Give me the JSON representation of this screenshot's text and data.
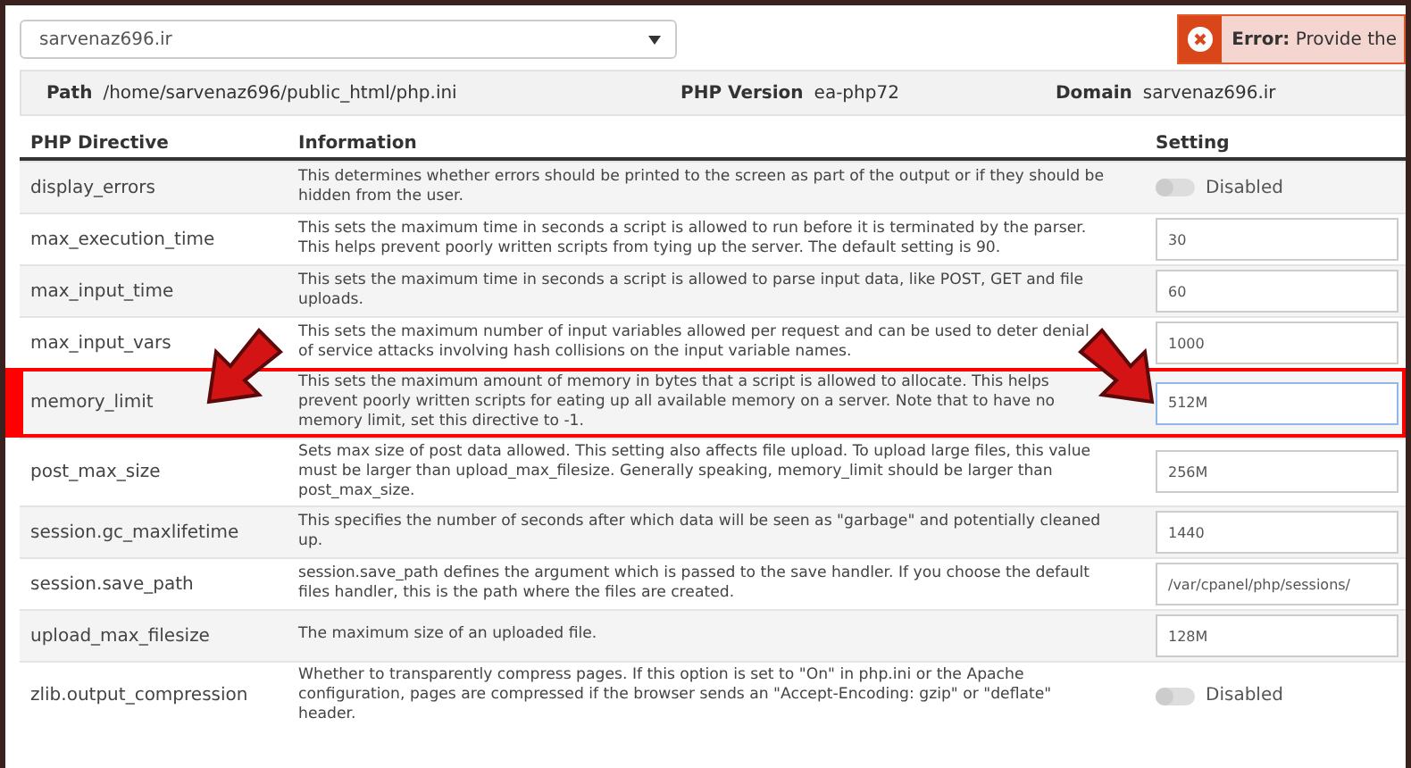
{
  "site_select": {
    "value": "sarvenaz696.ir"
  },
  "error": {
    "message": "**Error:** Provide the"
  },
  "info_bar": [
    {
      "label": "Path",
      "value": "/home/sarvenaz696/public_html/php.ini"
    },
    {
      "label": "PHP Version",
      "value": "ea-php72"
    },
    {
      "label": "Domain",
      "value": "sarvenaz696.ir"
    }
  ],
  "table": {
    "columns": [
      "PHP Directive",
      "Information",
      "Setting"
    ],
    "rows": [
      {
        "directive": "display_errors",
        "info": "This determines whether errors should be printed to the screen as part of the output or if they should be hidden from the user.",
        "kind": "toggle",
        "on": false,
        "value": "Disabled",
        "highlighted": false
      },
      {
        "directive": "max_execution_time",
        "info": "This sets the maximum time in seconds a script is allowed to run before it is terminated by the parser. This helps prevent poorly written scripts from tying up the server. The default setting is 90.",
        "kind": "text",
        "value": "30",
        "highlighted": false
      },
      {
        "directive": "max_input_time",
        "info": "This sets the maximum time in seconds a script is allowed to parse input data, like POST, GET and file uploads.",
        "kind": "text",
        "value": "60",
        "highlighted": false
      },
      {
        "directive": "max_input_vars",
        "info": "This sets the maximum number of input variables allowed per request and can be used to deter denial of service attacks involving hash collisions on the input variable names.",
        "kind": "text",
        "value": "1000",
        "highlighted": false
      },
      {
        "directive": "memory_limit",
        "info": "This sets the maximum amount of memory in bytes that a script is allowed to allocate. This helps prevent poorly written scripts for eating up all available memory on a server. Note that to have no memory limit, set this directive to -1.",
        "kind": "text",
        "value": "512M",
        "highlighted": true
      },
      {
        "directive": "post_max_size",
        "info": "Sets max size of post data allowed. This setting also affects file upload. To upload large files, this value must be larger than upload_max_filesize. Generally speaking, memory_limit should be larger than post_max_size.",
        "kind": "text",
        "value": "256M",
        "highlighted": false
      },
      {
        "directive": "session.gc_maxlifetime",
        "info": "This specifies the number of seconds after which data will be seen as \"garbage\" and potentially cleaned up.",
        "kind": "text",
        "value": "1440",
        "highlighted": false
      },
      {
        "directive": "session.save_path",
        "info": "session.save_path defines the argument which is passed to the save handler. If you choose the default files handler, this is the path where the files are created.",
        "kind": "text",
        "value": "/var/cpanel/php/sessions/",
        "highlighted": false
      },
      {
        "directive": "upload_max_filesize",
        "info": "The maximum size of an uploaded file.",
        "kind": "text",
        "value": "128M",
        "highlighted": false
      },
      {
        "directive": "zlib.output_compression",
        "info": "Whether to transparently compress pages. If this option is set to \"On\" in php.ini or the Apache configuration, pages are compressed if the browser sends an \"Accept-Encoding: gzip\" or \"deflate\" header.",
        "kind": "toggle",
        "on": false,
        "value": "Disabled",
        "highlighted": false
      }
    ]
  }
}
